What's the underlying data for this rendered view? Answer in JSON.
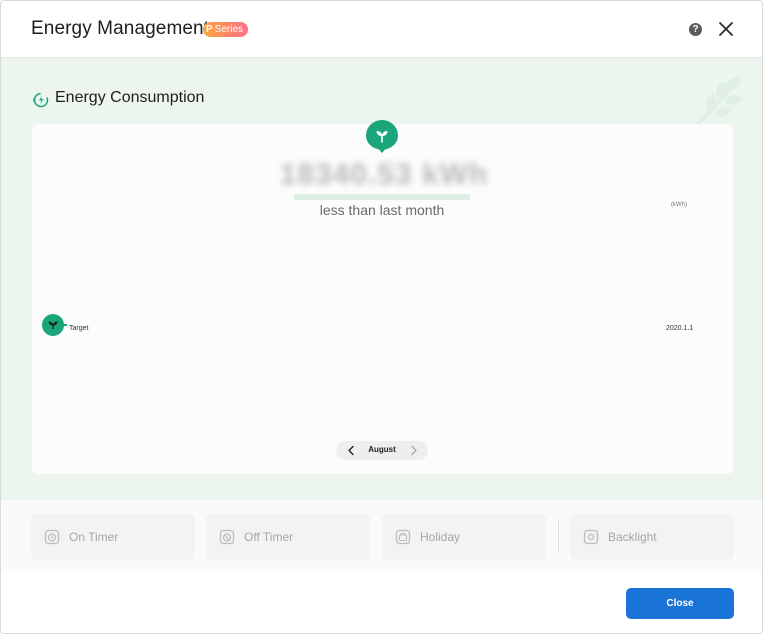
{
  "header": {
    "title": "Energy Management",
    "badge_prefix": "P",
    "badge_text": "Series",
    "help_icon": "help-icon",
    "close_icon": "close-icon"
  },
  "section": {
    "title": "Energy Consumption",
    "icon": "energy-plug-icon"
  },
  "card": {
    "value": "18340.53 kWh",
    "compare_text": "less than last month",
    "unit": "(kWh)",
    "target_label": "Target",
    "date_label": "2020.1.1",
    "month_nav": {
      "label": "August",
      "prev_icon": "chevron-left-icon",
      "next_icon": "chevron-right-icon"
    }
  },
  "functions": [
    {
      "label": "On Timer",
      "icon": "on-timer-icon"
    },
    {
      "label": "Off Timer",
      "icon": "off-timer-icon"
    },
    {
      "label": "Holiday",
      "icon": "holiday-icon"
    },
    {
      "label": "Backlight",
      "icon": "backlight-icon"
    }
  ],
  "footer": {
    "close_label": "Close"
  },
  "colors": {
    "accent_green": "#1aa67a",
    "content_bg": "#ecf6ee",
    "primary_button": "#1a73d6",
    "badge_gradient_start": "#ffa53d",
    "badge_gradient_end": "#ff6f8a"
  }
}
